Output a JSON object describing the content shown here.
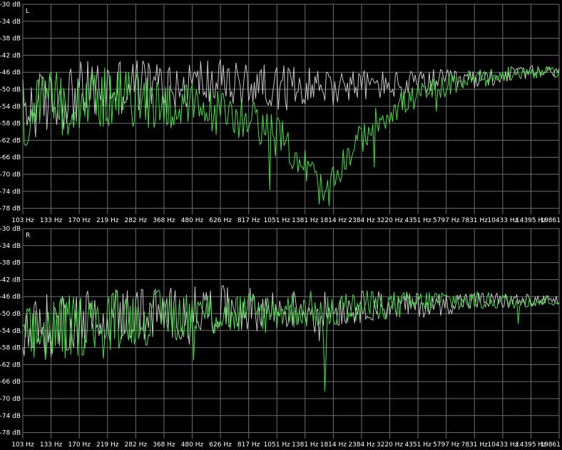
{
  "chart_data": [
    {
      "type": "line",
      "channel_label": "L",
      "x_tick_labels": [
        "103 Hz",
        "133 Hz",
        "170 Hz",
        "219 Hz",
        "282 Hz",
        "368 Hz",
        "480 Hz",
        "626 Hz",
        "817 Hz",
        "1051 Hz",
        "1381 Hz",
        "1814 Hz",
        "2384 Hz",
        "3220 Hz",
        "4351 Hz",
        "5797 Hz",
        "7831 Hz",
        "10433 Hz",
        "14395 Hz",
        "19861"
      ],
      "y_tick_labels": [
        "-30 dB",
        "-34 dB",
        "-38 dB",
        "-42 dB",
        "-46 dB",
        "-50 dB",
        "-54 dB",
        "-58 dB",
        "-62 dB",
        "-66 dB",
        "-70 dB",
        "-74 dB",
        "-78 dB"
      ],
      "xlim": [
        103,
        19861
      ],
      "x_scale": "log",
      "ylim": [
        -80,
        -30
      ],
      "grid": true,
      "series": [
        {
          "color": "#c8c8c8",
          "x": [
            103,
            133,
            170,
            219,
            282,
            368,
            480,
            626,
            817,
            1051,
            1381,
            1814,
            2384,
            3220,
            4351,
            5797,
            7831,
            10433,
            14395,
            19861
          ],
          "y": [
            -55,
            -53,
            -51,
            -50,
            -49,
            -49,
            -49,
            -48,
            -49,
            -49,
            -49,
            -49,
            -49,
            -49,
            -49,
            -48,
            -48,
            -47,
            -46,
            -46
          ]
        },
        {
          "color": "#3ee43e",
          "x": [
            103,
            133,
            170,
            219,
            282,
            368,
            480,
            626,
            817,
            1051,
            1381,
            1814,
            2000,
            2100,
            2384,
            3220,
            4351,
            5797,
            7831,
            10433,
            14395,
            19861
          ],
          "y": [
            -57,
            -54,
            -52,
            -52,
            -52,
            -53,
            -54,
            -55,
            -56,
            -58,
            -63,
            -71,
            -76,
            -74,
            -67,
            -58,
            -53,
            -50,
            -48,
            -47,
            -46,
            -46
          ]
        }
      ]
    },
    {
      "type": "line",
      "channel_label": "R",
      "x_tick_labels": [
        "103 Hz",
        "133 Hz",
        "170 Hz",
        "219 Hz",
        "282 Hz",
        "368 Hz",
        "480 Hz",
        "626 Hz",
        "817 Hz",
        "1051 Hz",
        "1381 Hz",
        "1814 Hz",
        "2384 Hz",
        "3220 Hz",
        "4351 Hz",
        "5797 Hz",
        "7831 Hz",
        "10433 Hz",
        "14395 Hz",
        "19861"
      ],
      "y_tick_labels": [
        "-30 dB",
        "-34 dB",
        "-38 dB",
        "-42 dB",
        "-46 dB",
        "-50 dB",
        "-54 dB",
        "-58 dB",
        "-62 dB",
        "-66 dB",
        "-70 dB",
        "-74 dB",
        "-78 dB"
      ],
      "xlim": [
        103,
        19861
      ],
      "x_scale": "log",
      "ylim": [
        -80,
        -30
      ],
      "grid": true,
      "series": [
        {
          "color": "#c8c8c8",
          "x": [
            103,
            133,
            170,
            219,
            282,
            368,
            480,
            626,
            817,
            1051,
            1381,
            1814,
            2384,
            3220,
            4351,
            5797,
            7831,
            10433,
            14395,
            19861
          ],
          "y": [
            -55,
            -53,
            -51,
            -51,
            -50,
            -50,
            -50,
            -49,
            -49,
            -49,
            -49,
            -49,
            -49,
            -48,
            -48,
            -48,
            -47,
            -47,
            -47,
            -47
          ]
        },
        {
          "color": "#3ee43e",
          "x": [
            103,
            133,
            170,
            219,
            282,
            368,
            480,
            626,
            817,
            1051,
            1381,
            1814,
            1950,
            2000,
            2050,
            2384,
            3220,
            4351,
            5797,
            7831,
            10433,
            14395,
            19861
          ],
          "y": [
            -57,
            -54,
            -53,
            -52,
            -51,
            -51,
            -50,
            -50,
            -50,
            -50,
            -49,
            -49,
            -50,
            -69,
            -50,
            -49,
            -48,
            -48,
            -47,
            -47,
            -47,
            -47,
            -47
          ]
        }
      ]
    }
  ]
}
